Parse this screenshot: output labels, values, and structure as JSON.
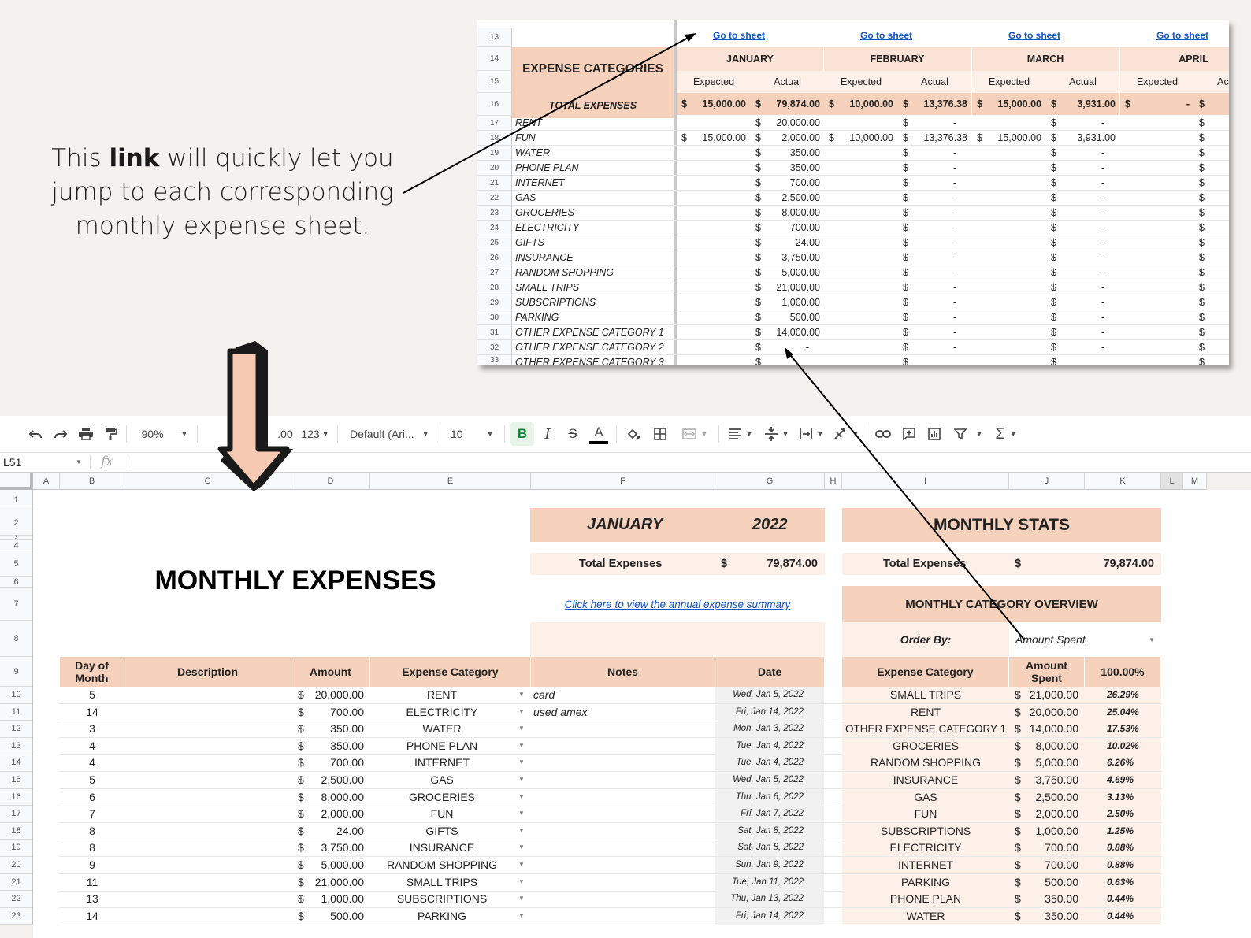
{
  "caption": {
    "pre": "This ",
    "bold": "link",
    "post": " will quickly let you jump to each corresponding monthly expense sheet."
  },
  "inset": {
    "row_numbers": [
      "13",
      "14",
      "15",
      "16",
      "17",
      "18",
      "19",
      "20",
      "21",
      "22",
      "23",
      "24",
      "25",
      "26",
      "27",
      "28",
      "29",
      "30",
      "31",
      "32",
      "33"
    ],
    "category_header": "EXPENSE CATEGORIES",
    "total_label": "TOTAL EXPENSES",
    "link_label": "Go to sheet",
    "months": [
      "JANUARY",
      "FEBRUARY",
      "MARCH",
      "APRIL"
    ],
    "sub_expected": "Expected",
    "sub_actual": "Actual",
    "currency": "$",
    "totals": [
      "15,000.00",
      "79,874.00",
      "10,000.00",
      "13,376.38",
      "15,000.00",
      "3,931.00",
      "-"
    ],
    "categories": [
      {
        "name": "RENT",
        "jan_exp": "",
        "jan_act": "20,000.00",
        "feb_exp": "",
        "feb_act": "-",
        "mar_exp": "",
        "mar_act": "-"
      },
      {
        "name": "FUN",
        "jan_exp": "15,000.00",
        "jan_act": "2,000.00",
        "feb_exp": "10,000.00",
        "feb_act": "13,376.38",
        "mar_exp": "15,000.00",
        "mar_act": "3,931.00"
      },
      {
        "name": "WATER",
        "jan_exp": "",
        "jan_act": "350.00",
        "feb_exp": "",
        "feb_act": "-",
        "mar_exp": "",
        "mar_act": "-"
      },
      {
        "name": "PHONE PLAN",
        "jan_exp": "",
        "jan_act": "350.00",
        "feb_exp": "",
        "feb_act": "-",
        "mar_exp": "",
        "mar_act": "-"
      },
      {
        "name": "INTERNET",
        "jan_exp": "",
        "jan_act": "700.00",
        "feb_exp": "",
        "feb_act": "-",
        "mar_exp": "",
        "mar_act": "-"
      },
      {
        "name": "GAS",
        "jan_exp": "",
        "jan_act": "2,500.00",
        "feb_exp": "",
        "feb_act": "-",
        "mar_exp": "",
        "mar_act": "-"
      },
      {
        "name": "GROCERIES",
        "jan_exp": "",
        "jan_act": "8,000.00",
        "feb_exp": "",
        "feb_act": "-",
        "mar_exp": "",
        "mar_act": "-"
      },
      {
        "name": "ELECTRICITY",
        "jan_exp": "",
        "jan_act": "700.00",
        "feb_exp": "",
        "feb_act": "-",
        "mar_exp": "",
        "mar_act": "-"
      },
      {
        "name": "GIFTS",
        "jan_exp": "",
        "jan_act": "24.00",
        "feb_exp": "",
        "feb_act": "-",
        "mar_exp": "",
        "mar_act": "-"
      },
      {
        "name": "INSURANCE",
        "jan_exp": "",
        "jan_act": "3,750.00",
        "feb_exp": "",
        "feb_act": "-",
        "mar_exp": "",
        "mar_act": "-"
      },
      {
        "name": "RANDOM SHOPPING",
        "jan_exp": "",
        "jan_act": "5,000.00",
        "feb_exp": "",
        "feb_act": "-",
        "mar_exp": "",
        "mar_act": "-"
      },
      {
        "name": "SMALL TRIPS",
        "jan_exp": "",
        "jan_act": "21,000.00",
        "feb_exp": "",
        "feb_act": "-",
        "mar_exp": "",
        "mar_act": "-"
      },
      {
        "name": "SUBSCRIPTIONS",
        "jan_exp": "",
        "jan_act": "1,000.00",
        "feb_exp": "",
        "feb_act": "-",
        "mar_exp": "",
        "mar_act": "-"
      },
      {
        "name": "PARKING",
        "jan_exp": "",
        "jan_act": "500.00",
        "feb_exp": "",
        "feb_act": "-",
        "mar_exp": "",
        "mar_act": "-"
      },
      {
        "name": "OTHER EXPENSE CATEGORY 1",
        "jan_exp": "",
        "jan_act": "14,000.00",
        "feb_exp": "",
        "feb_act": "-",
        "mar_exp": "",
        "mar_act": "-"
      },
      {
        "name": "OTHER EXPENSE CATEGORY 2",
        "jan_exp": "",
        "jan_act": "-",
        "feb_exp": "",
        "feb_act": "-",
        "mar_exp": "",
        "mar_act": "-"
      },
      {
        "name": "OTHER EXPENSE CATEGORY 3",
        "jan_exp": "",
        "jan_act": "",
        "feb_exp": "",
        "feb_act": "",
        "mar_exp": "",
        "mar_act": ""
      }
    ]
  },
  "toolbar": {
    "zoom": "90%",
    "decimal": ".00",
    "format": "123",
    "font": "Default (Ari...",
    "font_size": "10",
    "bold": "B",
    "italic": "I",
    "strike": "S",
    "text_color": "A",
    "sum": "Σ"
  },
  "formula": {
    "cell_ref": "L51",
    "fx": "fx"
  },
  "columns": [
    "A",
    "B",
    "C",
    "D",
    "E",
    "F",
    "G",
    "H",
    "I",
    "J",
    "K",
    "L",
    "M"
  ],
  "rows": [
    "1",
    "2",
    "3",
    "4",
    "5",
    "6",
    "7",
    "8",
    "9",
    "10",
    "11",
    "12",
    "13",
    "14",
    "15",
    "16",
    "17",
    "18",
    "19",
    "20",
    "21",
    "22",
    "23"
  ],
  "sheet": {
    "title": "MONTHLY EXPENSES",
    "month": "JANUARY",
    "year": "2022",
    "total_label": "Total Expenses",
    "currency": "$",
    "total_value": "79,874.00",
    "summary_link": "Click here to view the annual expense summary",
    "stats_title": "MONTHLY STATS",
    "stats_total_label": "Total Expenses",
    "stats_total_value": "79,874.00",
    "overview_title": "MONTHLY CATEGORY OVERVIEW",
    "order_by_label": "Order By:",
    "order_by_value": "Amount Spent",
    "headers": {
      "day": "Day of Month",
      "desc": "Description",
      "amount": "Amount",
      "category": "Expense Category",
      "notes": "Notes",
      "date": "Date"
    },
    "stats_headers": {
      "category": "Expense Category",
      "amount": "Amount Spent",
      "pct": "100.00%"
    },
    "entries": [
      {
        "day": "5",
        "amount": "20,000.00",
        "category": "RENT",
        "notes": "card",
        "date": "Wed, Jan 5, 2022"
      },
      {
        "day": "14",
        "amount": "700.00",
        "category": "ELECTRICITY",
        "notes": "used amex",
        "date": "Fri, Jan 14, 2022"
      },
      {
        "day": "3",
        "amount": "350.00",
        "category": "WATER",
        "notes": "",
        "date": "Mon, Jan 3, 2022"
      },
      {
        "day": "4",
        "amount": "350.00",
        "category": "PHONE PLAN",
        "notes": "",
        "date": "Tue, Jan 4, 2022"
      },
      {
        "day": "4",
        "amount": "700.00",
        "category": "INTERNET",
        "notes": "",
        "date": "Tue, Jan 4, 2022"
      },
      {
        "day": "5",
        "amount": "2,500.00",
        "category": "GAS",
        "notes": "",
        "date": "Wed, Jan 5, 2022"
      },
      {
        "day": "6",
        "amount": "8,000.00",
        "category": "GROCERIES",
        "notes": "",
        "date": "Thu, Jan 6, 2022"
      },
      {
        "day": "7",
        "amount": "2,000.00",
        "category": "FUN",
        "notes": "",
        "date": "Fri, Jan 7, 2022"
      },
      {
        "day": "8",
        "amount": "24.00",
        "category": "GIFTS",
        "notes": "",
        "date": "Sat, Jan 8, 2022"
      },
      {
        "day": "8",
        "amount": "3,750.00",
        "category": "INSURANCE",
        "notes": "",
        "date": "Sat, Jan 8, 2022"
      },
      {
        "day": "9",
        "amount": "5,000.00",
        "category": "RANDOM SHOPPING",
        "notes": "",
        "date": "Sun, Jan 9, 2022"
      },
      {
        "day": "11",
        "amount": "21,000.00",
        "category": "SMALL TRIPS",
        "notes": "",
        "date": "Tue, Jan 11, 2022"
      },
      {
        "day": "13",
        "amount": "1,000.00",
        "category": "SUBSCRIPTIONS",
        "notes": "",
        "date": "Thu, Jan 13, 2022"
      },
      {
        "day": "14",
        "amount": "500.00",
        "category": "PARKING",
        "notes": "",
        "date": "Fri, Jan 14, 2022"
      }
    ],
    "stats": [
      {
        "category": "SMALL TRIPS",
        "amount": "21,000.00",
        "pct": "26.29%"
      },
      {
        "category": "RENT",
        "amount": "20,000.00",
        "pct": "25.04%"
      },
      {
        "category": "OTHER EXPENSE CATEGORY 1",
        "amount": "14,000.00",
        "pct": "17.53%"
      },
      {
        "category": "GROCERIES",
        "amount": "8,000.00",
        "pct": "10.02%"
      },
      {
        "category": "RANDOM SHOPPING",
        "amount": "5,000.00",
        "pct": "6.26%"
      },
      {
        "category": "INSURANCE",
        "amount": "3,750.00",
        "pct": "4.69%"
      },
      {
        "category": "GAS",
        "amount": "2,500.00",
        "pct": "3.13%"
      },
      {
        "category": "FUN",
        "amount": "2,000.00",
        "pct": "2.50%"
      },
      {
        "category": "SUBSCRIPTIONS",
        "amount": "1,000.00",
        "pct": "1.25%"
      },
      {
        "category": "ELECTRICITY",
        "amount": "700.00",
        "pct": "0.88%"
      },
      {
        "category": "INTERNET",
        "amount": "700.00",
        "pct": "0.88%"
      },
      {
        "category": "PARKING",
        "amount": "500.00",
        "pct": "0.63%"
      },
      {
        "category": "PHONE PLAN",
        "amount": "350.00",
        "pct": "0.44%"
      },
      {
        "category": "WATER",
        "amount": "350.00",
        "pct": "0.44%"
      }
    ]
  },
  "colors": {
    "peach": "#f6d2bd",
    "light_peach": "#fdf0e8",
    "link": "#1155cc",
    "arrow_fill": "#f6c9b3"
  }
}
